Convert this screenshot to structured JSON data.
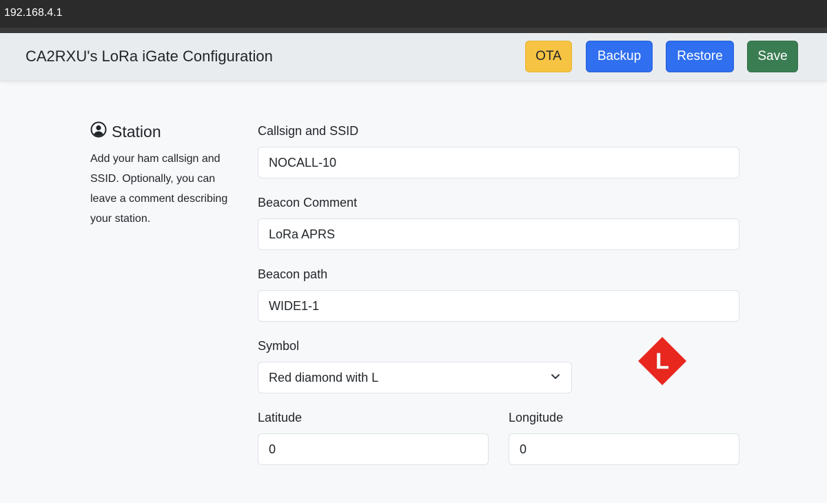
{
  "browser": {
    "address": "192.168.4.1"
  },
  "header": {
    "title": "CA2RXU's LoRa iGate Configuration",
    "buttons": {
      "ota": "OTA",
      "backup": "Backup",
      "restore": "Restore",
      "save": "Save"
    }
  },
  "station": {
    "title": "Station",
    "icon": "person-circle-icon",
    "description": "Add your ham callsign and SSID. Optionally, you can leave a comment describing your station.",
    "fields": {
      "callsign": {
        "label": "Callsign and SSID",
        "value": "NOCALL-10"
      },
      "comment": {
        "label": "Beacon Comment",
        "value": "LoRa APRS"
      },
      "path": {
        "label": "Beacon path",
        "value": "WIDE1-1"
      },
      "symbol": {
        "label": "Symbol",
        "value": "Red diamond with L",
        "preview_letter": "L",
        "preview_color": "#e8271e"
      },
      "latitude": {
        "label": "Latitude",
        "value": "0"
      },
      "longitude": {
        "label": "Longitude",
        "value": "0"
      }
    }
  },
  "colors": {
    "ota": "#f6c343",
    "primary": "#2f6ff0",
    "success": "#3b7d52"
  }
}
